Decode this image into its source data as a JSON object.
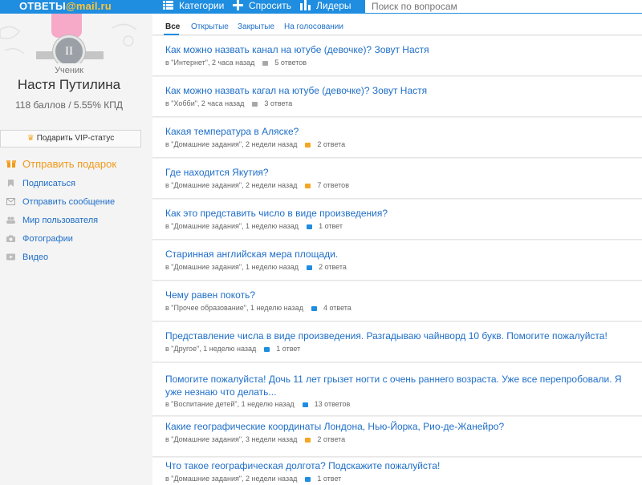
{
  "header": {
    "logo_left": "ОТВЕТЫ",
    "logo_right": "@mail.ru",
    "nav": [
      {
        "label": "Категории"
      },
      {
        "label": "Спросить"
      },
      {
        "label": "Лидеры"
      }
    ],
    "search_placeholder": "Поиск по вопросам"
  },
  "profile": {
    "badge_numeral": "II",
    "rank": "Ученик",
    "name": "Настя Путилина",
    "stats": "118 баллов / 5.55% КПД",
    "vip_label": "Подарить VIP-статус",
    "gift_label": "Отправить подарок",
    "links": [
      {
        "label": "Подписаться",
        "icon": "bookmark-icon"
      },
      {
        "label": "Отправить сообщение",
        "icon": "envelope-icon"
      },
      {
        "label": "Мир пользователя",
        "icon": "people-icon"
      },
      {
        "label": "Фотографии",
        "icon": "camera-icon"
      },
      {
        "label": "Видео",
        "icon": "video-icon"
      }
    ]
  },
  "tabs": [
    {
      "label": "Все",
      "active": true
    },
    {
      "label": "Открытые"
    },
    {
      "label": "Закрытые"
    },
    {
      "label": "На голосовании"
    }
  ],
  "questions": [
    {
      "title": "Как можно назвать канал на ютубе (девочке)? Зовут Настя",
      "meta": "в \"Интернет\", 2 часа назад",
      "answers": "5 ответов",
      "status": "gray"
    },
    {
      "title": "Как можно назвать кагал на ютубе (девочке)? Зовут Настя",
      "meta": "в \"Хобби\", 2 часа назад",
      "answers": "3 ответа",
      "status": "gray"
    },
    {
      "title": "Какая температура в Аляске?",
      "meta": "в \"Домашние задания\", 2 недели назад",
      "answers": "2 ответа",
      "status": "orange"
    },
    {
      "title": "Где находится Якутия?",
      "meta": "в \"Домашние задания\", 2 недели назад",
      "answers": "7 ответов",
      "status": "orange"
    },
    {
      "title": "Как это представить число в виде произведения?",
      "meta": "в \"Домашние задания\", 1 неделю назад",
      "answers": "1 ответ",
      "status": "blue"
    },
    {
      "title": "Старинная английская мера площади.",
      "meta": "в \"Домашние задания\", 1 неделю назад",
      "answers": "2 ответа",
      "status": "blue"
    },
    {
      "title": "Чему равен покоть?",
      "meta": "в \"Прочее образование\", 1 неделю назад",
      "answers": "4 ответа",
      "status": "blue"
    },
    {
      "title": "Представление числа в виде произведения. Разгадываю чайнворд 10 букв. Помогите пожалуйста!",
      "meta": "в \"Другое\", 1 неделю назад",
      "answers": "1 ответ",
      "status": "blue"
    },
    {
      "title": "Помогите пожалуйста! Дочь 11 лет грызет ногти с очень раннего возраста. Уже все перепробовали. Я уже незнаю что делать...",
      "meta": "в \"Воспитание детей\", 1 неделю назад",
      "answers": "13 ответов",
      "status": "blue"
    },
    {
      "title": "Какие географические координаты Лондона, Нью-Йорка, Рио-де-Жанейро?",
      "meta": "в \"Домашние задания\", 3 недели назад",
      "answers": "2 ответа",
      "status": "orange"
    },
    {
      "title": "Что такое географическая долгота? Подскажите пожалуйста!",
      "meta": "в \"Домашние задания\", 2 недели назад",
      "answers": "1 ответ",
      "status": "blue"
    }
  ]
}
